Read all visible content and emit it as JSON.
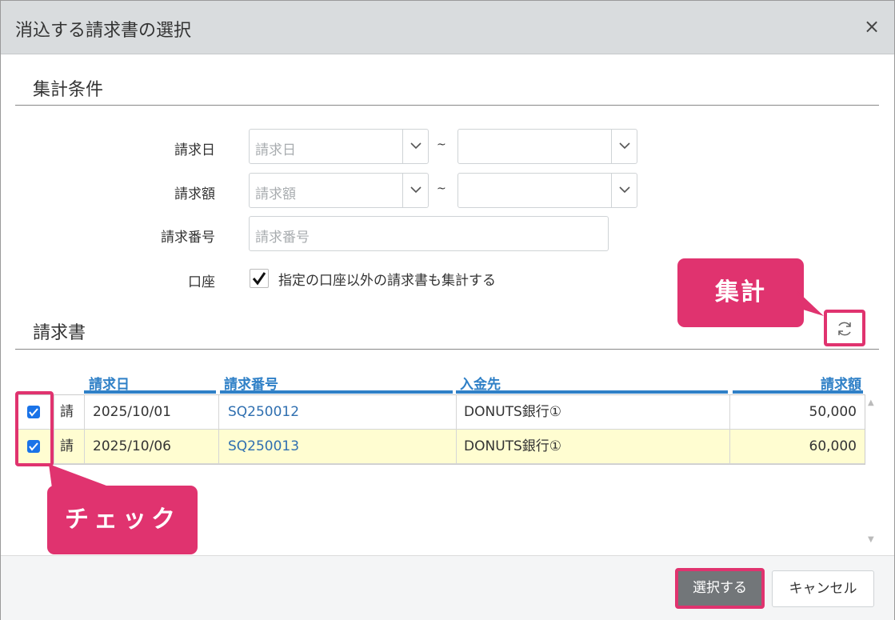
{
  "dialog": {
    "title": "消込する請求書の選択",
    "close_label": "×"
  },
  "conditions": {
    "heading": "集計条件",
    "invoice_date": {
      "label": "請求日",
      "from_placeholder": "請求日",
      "to_placeholder": "",
      "separator": "~"
    },
    "invoice_amount": {
      "label": "請求額",
      "from_placeholder": "請求額",
      "to_placeholder": "",
      "separator": "~"
    },
    "invoice_number": {
      "label": "請求番号",
      "placeholder": "請求番号"
    },
    "account": {
      "label": "口座",
      "checkbox_label": "指定の口座以外の請求書も集計する",
      "checked": true
    }
  },
  "invoices": {
    "heading": "請求書",
    "columns": {
      "date": "請求日",
      "number": "請求番号",
      "payee": "入金先",
      "amount": "請求額"
    },
    "rows": [
      {
        "checked": true,
        "type": "請",
        "date": "2025/10/01",
        "number": "SQ250012",
        "payee": "DONUTS銀行①",
        "amount": "50,000"
      },
      {
        "checked": true,
        "type": "請",
        "date": "2025/10/06",
        "number": "SQ250013",
        "payee": "DONUTS銀行①",
        "amount": "60,000"
      }
    ]
  },
  "annotations": {
    "aggregate": "集計",
    "check": "チェック",
    "accent_color": "#e0336f"
  },
  "footer": {
    "select_label": "選択する",
    "cancel_label": "キャンセル"
  },
  "icons": {
    "close": "close-icon",
    "dropdown": "chevron-down-icon",
    "refresh": "refresh-icon",
    "checkmark": "checkmark-icon"
  },
  "colors": {
    "header_text": "#2f80c7",
    "link": "#2f6fb0",
    "selected_row": "#fffdd1",
    "title_bar": "#d9dcde",
    "primary_button": "#727679"
  }
}
